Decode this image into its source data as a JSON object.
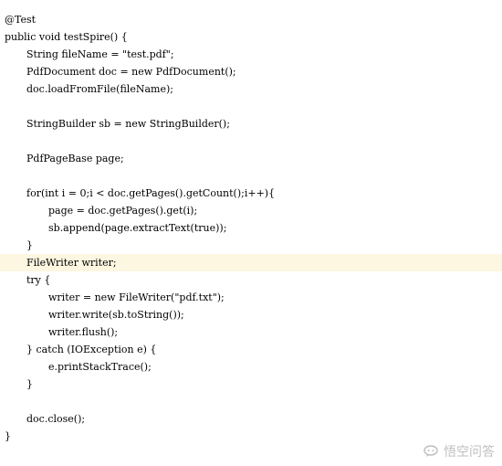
{
  "code": {
    "lines": [
      {
        "text": "@Test",
        "indent": 0,
        "highlight": false
      },
      {
        "text": "public void testSpire() {",
        "indent": 0,
        "highlight": false
      },
      {
        "text": "String fileName = \"test.pdf\";",
        "indent": 1,
        "highlight": false
      },
      {
        "text": "PdfDocument doc = new PdfDocument();",
        "indent": 1,
        "highlight": false
      },
      {
        "text": "doc.loadFromFile(fileName);",
        "indent": 1,
        "highlight": false
      },
      {
        "text": "",
        "indent": 0,
        "highlight": false
      },
      {
        "text": "StringBuilder sb = new StringBuilder();",
        "indent": 1,
        "highlight": false
      },
      {
        "text": "",
        "indent": 0,
        "highlight": false
      },
      {
        "text": "PdfPageBase page;",
        "indent": 1,
        "highlight": false
      },
      {
        "text": "",
        "indent": 0,
        "highlight": false
      },
      {
        "text": "for(int i = 0;i < doc.getPages().getCount();i++){",
        "indent": 1,
        "highlight": false
      },
      {
        "text": "page = doc.getPages().get(i);",
        "indent": 2,
        "highlight": false
      },
      {
        "text": "sb.append(page.extractText(true));",
        "indent": 2,
        "highlight": false
      },
      {
        "text": "}",
        "indent": 1,
        "highlight": false
      },
      {
        "text": "FileWriter writer;",
        "indent": 1,
        "highlight": true
      },
      {
        "text": "try {",
        "indent": 1,
        "highlight": false
      },
      {
        "text": "writer = new FileWriter(\"pdf.txt\");",
        "indent": 2,
        "highlight": false
      },
      {
        "text": "writer.write(sb.toString());",
        "indent": 2,
        "highlight": false
      },
      {
        "text": "writer.flush();",
        "indent": 2,
        "highlight": false
      },
      {
        "text": "} catch (IOException e) {",
        "indent": 1,
        "highlight": false
      },
      {
        "text": "e.printStackTrace();",
        "indent": 2,
        "highlight": false
      },
      {
        "text": "}",
        "indent": 1,
        "highlight": false
      },
      {
        "text": "",
        "indent": 0,
        "highlight": false
      },
      {
        "text": "doc.close();",
        "indent": 1,
        "highlight": false
      },
      {
        "text": "}",
        "indent": 0,
        "highlight": false
      }
    ]
  },
  "colors": {
    "background": "#ffffff",
    "text": "#000000",
    "current_line_highlight": "#fdf7e1"
  },
  "watermark": {
    "icon": "chat-bubble-logo-icon",
    "text": "悟空问答"
  }
}
